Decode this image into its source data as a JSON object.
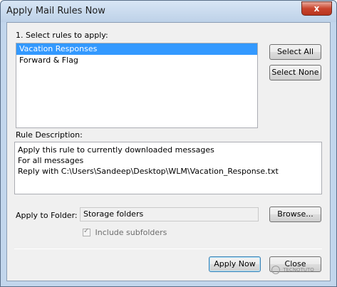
{
  "window": {
    "title": "Apply Mail Rules Now",
    "close_glyph": "x"
  },
  "rules": {
    "label": "1. Select rules to apply:",
    "items": [
      {
        "label": "Vacation Responses",
        "selected": true
      },
      {
        "label": "Forward & Flag",
        "selected": false
      }
    ],
    "select_all_label": "Select All",
    "select_none_label": "Select None"
  },
  "description": {
    "label": "Rule Description:",
    "lines": [
      "Apply this rule to currently downloaded messages",
      "For all messages",
      "Reply with C:\\Users\\Sandeep\\Desktop\\WLM\\Vacation_Response.txt"
    ]
  },
  "folder": {
    "label": "Apply to Folder:",
    "value": "Storage folders",
    "browse_label": "Browse...",
    "include_subfolders_label": "Include subfolders",
    "include_subfolders_checked": true
  },
  "footer": {
    "apply_now_label": "Apply Now",
    "close_label": "Close"
  },
  "watermark": {
    "text": "TECNOTUTO"
  }
}
